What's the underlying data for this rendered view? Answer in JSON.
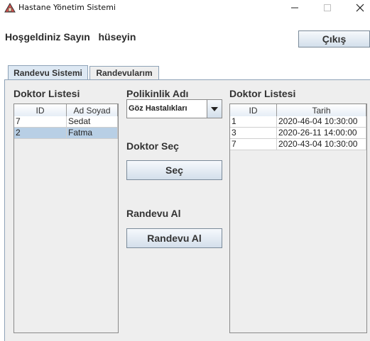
{
  "window": {
    "title": "Hastane Yönetim Sistemi",
    "controls": {
      "minimize": "—",
      "maximize": "☐",
      "close": "✕"
    }
  },
  "header": {
    "welcome_text": "Hoşgeldiniz Sayın   hüseyin",
    "exit_label": "Çıkış"
  },
  "tabs": [
    {
      "label": "Randevu Sistemi",
      "active": true
    },
    {
      "label": "Randevularım",
      "active": false
    }
  ],
  "left_panel": {
    "label": "Doktor Listesi",
    "columns": [
      "ID",
      "Ad Soyad"
    ],
    "rows": [
      {
        "id": "7",
        "name": "Sedat",
        "selected": false
      },
      {
        "id": "2",
        "name": "Fatma",
        "selected": true
      }
    ]
  },
  "middle_panel": {
    "clinic_label": "Polikinlik Adı",
    "clinic_selected": "Göz Hastalıkları",
    "doctor_select_label": "Doktor Seç",
    "select_button": "Seç",
    "appointment_label": "Randevu Al",
    "appointment_button": "Randevu Al"
  },
  "right_panel": {
    "label": "Doktor Listesi",
    "columns": [
      "ID",
      "Tarih"
    ],
    "rows": [
      {
        "id": "1",
        "date": "2020-46-04 10:30:00"
      },
      {
        "id": "3",
        "date": "2020-26-11 14:00:00"
      },
      {
        "id": "7",
        "date": "2020-43-04 10:30:00"
      }
    ]
  },
  "colors": {
    "tab_active": "#dde8f3",
    "selected_row": "#b8cfe5",
    "button_top": "#f6f9fc",
    "button_bottom": "#d3dfeb"
  }
}
